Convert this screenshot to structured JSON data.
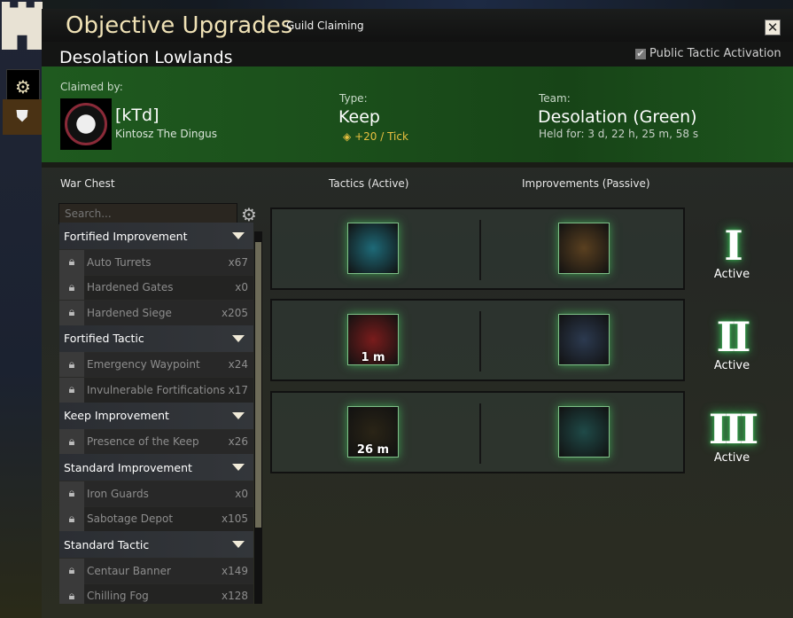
{
  "window": {
    "title": "Objective Upgrades",
    "tab": "Guild Claiming",
    "close_icon": "close-icon"
  },
  "location": "Desolation Lowlands",
  "public_tactic_activation": {
    "label": "Public Tactic Activation",
    "checked": true
  },
  "claim": {
    "claimed_by_label": "Claimed by:",
    "guild_tag": "[kTd]",
    "guild_name": "Kintosz The Dingus",
    "type_label": "Type:",
    "type": "Keep",
    "tick_amount": "+20",
    "tick_unit": "/ Tick",
    "team_label": "Team:",
    "team": "Desolation (Green)",
    "held_for": "Held for: 3 d, 22 h, 25 m, 58 s"
  },
  "columns": {
    "war_chest": "War Chest",
    "tactics": "Tactics (Active)",
    "improvements": "Improvements (Passive)"
  },
  "search": {
    "placeholder": "Search..."
  },
  "war_chest": [
    {
      "category": "Fortified Improvement",
      "items": [
        {
          "name": "Auto Turrets",
          "count": "x67"
        },
        {
          "name": "Hardened Gates",
          "count": "x0"
        },
        {
          "name": "Hardened Siege",
          "count": "x205"
        }
      ]
    },
    {
      "category": "Fortified Tactic",
      "items": [
        {
          "name": "Emergency Waypoint",
          "count": "x24"
        },
        {
          "name": "Invulnerable Fortifications",
          "count": "x17"
        }
      ]
    },
    {
      "category": "Keep Improvement",
      "items": [
        {
          "name": "Presence of the Keep",
          "count": "x26"
        }
      ]
    },
    {
      "category": "Standard Improvement",
      "items": [
        {
          "name": "Iron Guards",
          "count": "x0"
        },
        {
          "name": "Sabotage Depot",
          "count": "x105"
        }
      ]
    },
    {
      "category": "Standard Tactic",
      "items": [
        {
          "name": "Centaur Banner",
          "count": "x149"
        },
        {
          "name": "Chilling Fog",
          "count": "x128"
        }
      ]
    }
  ],
  "tiers": [
    {
      "numeral": "I",
      "status": "Active",
      "tactic_timer": "",
      "tactic_color": "#1e6a78",
      "improvement_color": "#5a4020"
    },
    {
      "numeral": "II",
      "status": "Active",
      "tactic_timer": "1 m",
      "tactic_color": "#7a1c1c",
      "improvement_color": "#2c3a50"
    },
    {
      "numeral": "III",
      "status": "Active",
      "tactic_timer": "26 m",
      "tactic_color": "#2a2416",
      "improvement_color": "#1f4a48"
    }
  ]
}
